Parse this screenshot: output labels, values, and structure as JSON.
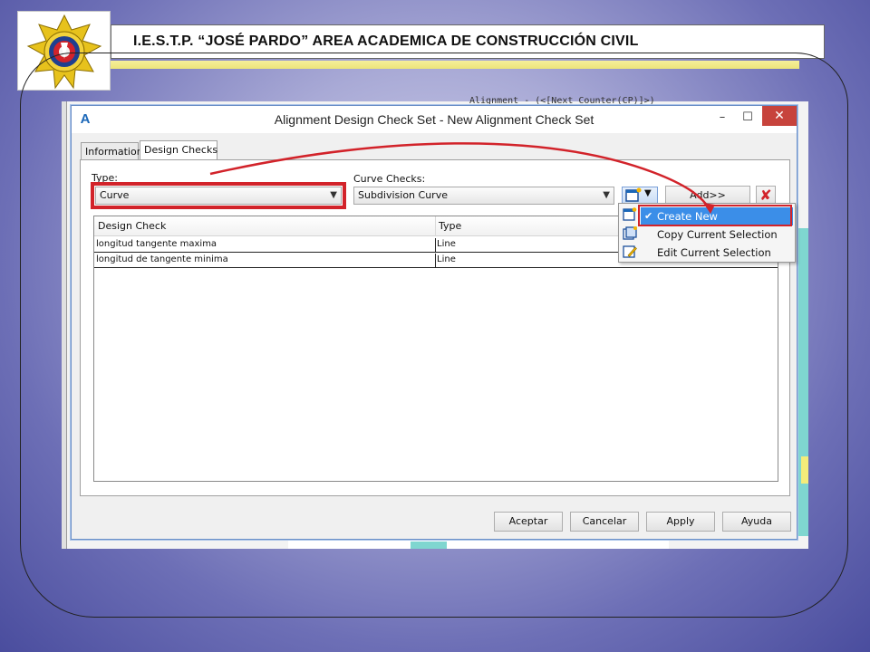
{
  "slide": {
    "header_title": "I.E.S.T.P. “JOSÉ PARDO” AREA ACADEMICA DE CONSTRUCCIÓN CIVIL",
    "colors": {
      "accent_red": "#d2232a",
      "header_yellow": "#ece47a",
      "menu_highlight": "#3b8ee8"
    }
  },
  "background_app": {
    "snippet": "Alignment - (<[Next Counter(CP)]>)"
  },
  "dialog": {
    "app_icon": "A",
    "title": "Alignment Design Check Set - New Alignment Check Set",
    "window_buttons": {
      "minimize": "–",
      "maximize": "☐",
      "close": "✕"
    },
    "tabs": [
      {
        "label": "Information",
        "active": false
      },
      {
        "label": "Design Checks",
        "active": true
      }
    ],
    "type_label": "Type:",
    "type_value": "Curve",
    "curve_checks_label": "Curve Checks:",
    "curve_checks_value": "Subdivision Curve",
    "add_button": "Add>>",
    "delete_icon": "✘",
    "grid": {
      "columns": [
        "Design Check",
        "Type"
      ],
      "rows": [
        {
          "design_check": "longitud tangente maxima",
          "type": "Line"
        },
        {
          "design_check": "longitud de tangente minima",
          "type": "Line"
        }
      ]
    },
    "menu": {
      "items": [
        {
          "label": "Create New",
          "selected": true,
          "icon": "new-check-icon"
        },
        {
          "label": "Copy Current Selection",
          "selected": false,
          "icon": "copy-check-icon"
        },
        {
          "label": "Edit Current Selection",
          "selected": false,
          "icon": "edit-check-icon"
        }
      ]
    },
    "buttons": {
      "accept": "Aceptar",
      "cancel": "Cancelar",
      "apply": "Apply",
      "help": "Ayuda"
    }
  }
}
